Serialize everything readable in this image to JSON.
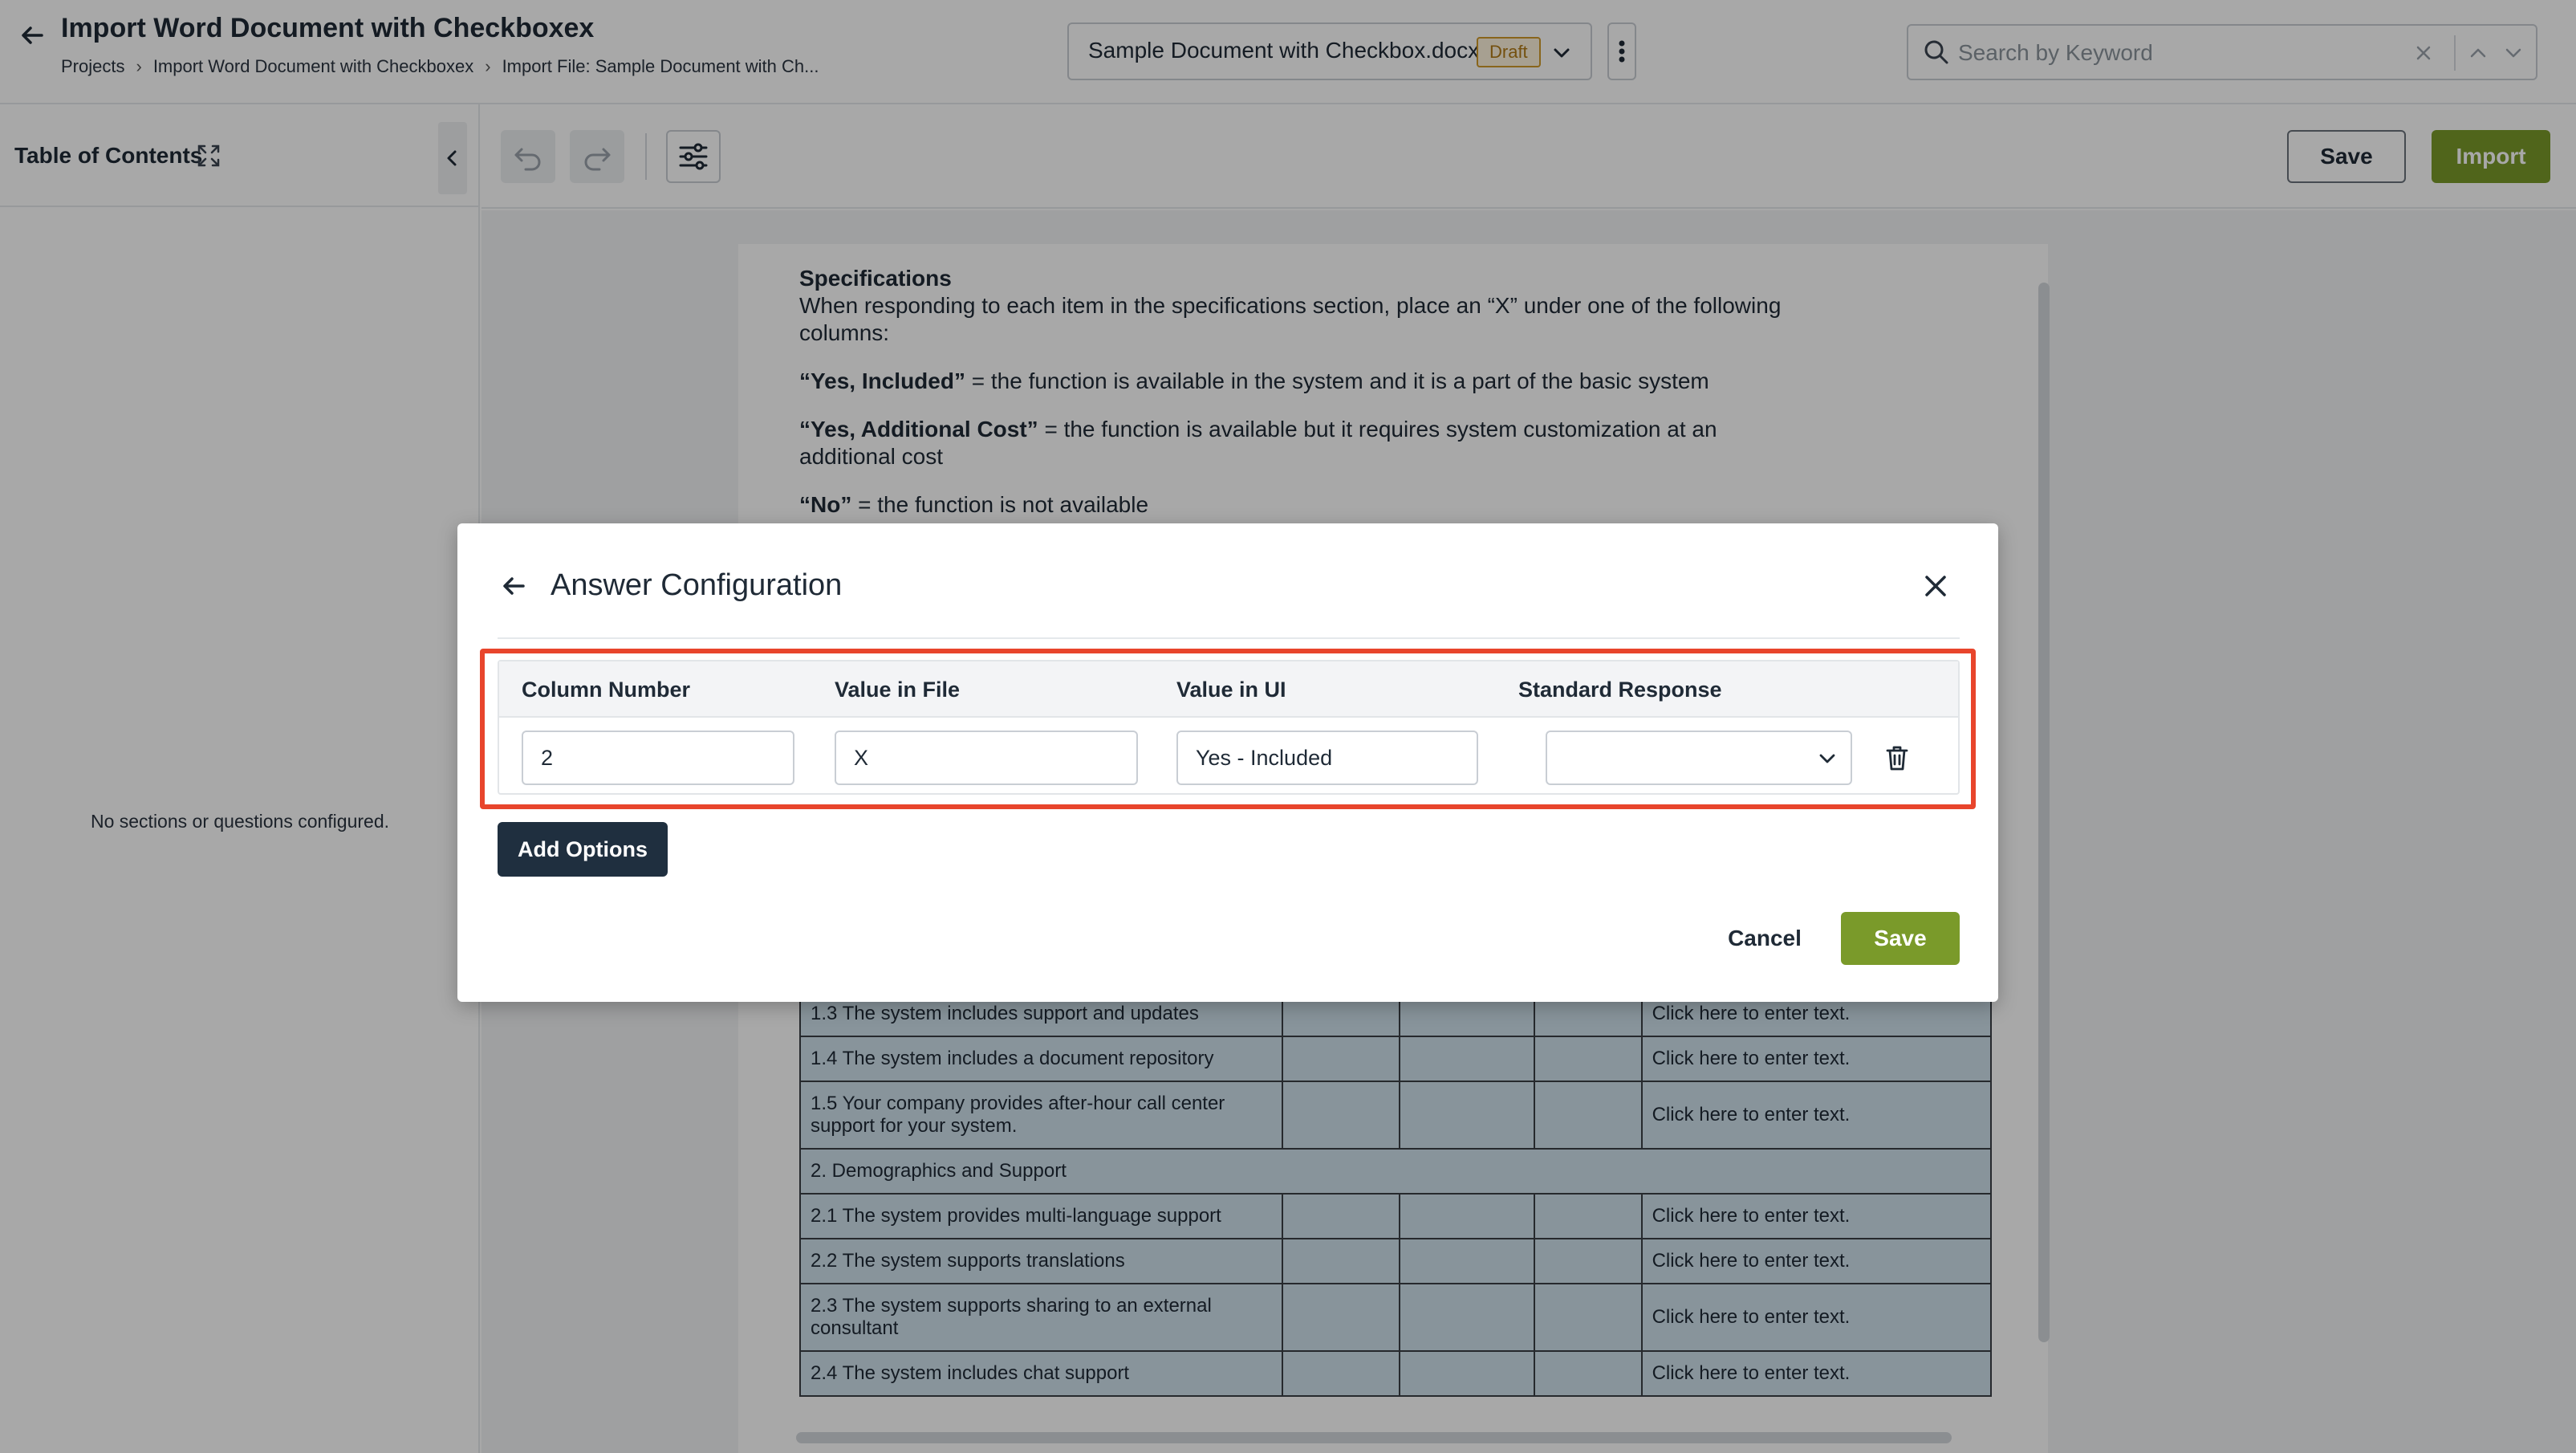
{
  "header": {
    "title": "Import Word Document with Checkboxex",
    "breadcrumbs": [
      "Projects",
      "Import Word Document with Checkboxex",
      "Import File:  Sample Document with Ch..."
    ],
    "document": {
      "name": "Sample Document with Checkbox.docx",
      "status": "Draft"
    },
    "search": {
      "placeholder": "Search by Keyword",
      "value": ""
    }
  },
  "left_panel": {
    "title": "Table of Contents",
    "empty_message": "No sections or questions configured."
  },
  "toolbar": {
    "save_label": "Save",
    "import_label": "Import"
  },
  "document": {
    "heading": "Specifications",
    "intro": "When responding to each item in the specifications section, place an “X” under one of the following columns:",
    "defs": [
      {
        "term": "“Yes, Included”",
        "text": " = the function is available in the system and it is a part of the basic system"
      },
      {
        "term": "“Yes, Additional Cost”",
        "text": " = the function is available but it requires system customization at an additional cost"
      },
      {
        "term": "“No”",
        "text": " = the function is not available"
      }
    ],
    "table_rows": [
      {
        "type": "item",
        "text": "1.3 The system includes support and updates",
        "response": "Click here to enter text."
      },
      {
        "type": "item",
        "text": "1.4 The system includes a document repository",
        "response": "Click here to enter text."
      },
      {
        "type": "item",
        "text": "1.5 Your company provides after-hour call center support for your system.",
        "response": "Click here to enter text."
      },
      {
        "type": "section",
        "text": "2. Demographics and Support"
      },
      {
        "type": "item",
        "text": "2.1 The system provides multi-language support",
        "response": "Click here to enter text."
      },
      {
        "type": "item",
        "text": "2.2 The system supports translations",
        "response": "Click here to enter text."
      },
      {
        "type": "item",
        "text": "2.3 The system supports sharing to an external consultant",
        "response": "Click here to enter text."
      },
      {
        "type": "item",
        "text": "2.4 The system includes chat support",
        "response": "Click here to enter text."
      }
    ]
  },
  "modal": {
    "title": "Answer Configuration",
    "columns": [
      "Column Number",
      "Value in File",
      "Value in UI",
      "Standard Response"
    ],
    "row": {
      "column_number": "2",
      "value_in_file": "X",
      "value_in_ui": "Yes - Included",
      "standard_response": ""
    },
    "add_options_label": "Add Options",
    "cancel_label": "Cancel",
    "save_label": "Save"
  },
  "colors": {
    "accent_green": "#7a9a2a",
    "dark_button": "#1f2f3f",
    "highlight_red": "#e8452c",
    "draft_badge": "#d19a2a"
  },
  "icons": [
    "arrow-left-icon",
    "chevron-right-icon",
    "chevron-down-icon",
    "kebab-icon",
    "search-icon",
    "close-icon",
    "chevron-up-icon",
    "expand-icon",
    "chevron-left-icon",
    "undo-icon",
    "redo-icon",
    "filter-icon",
    "trash-icon"
  ]
}
